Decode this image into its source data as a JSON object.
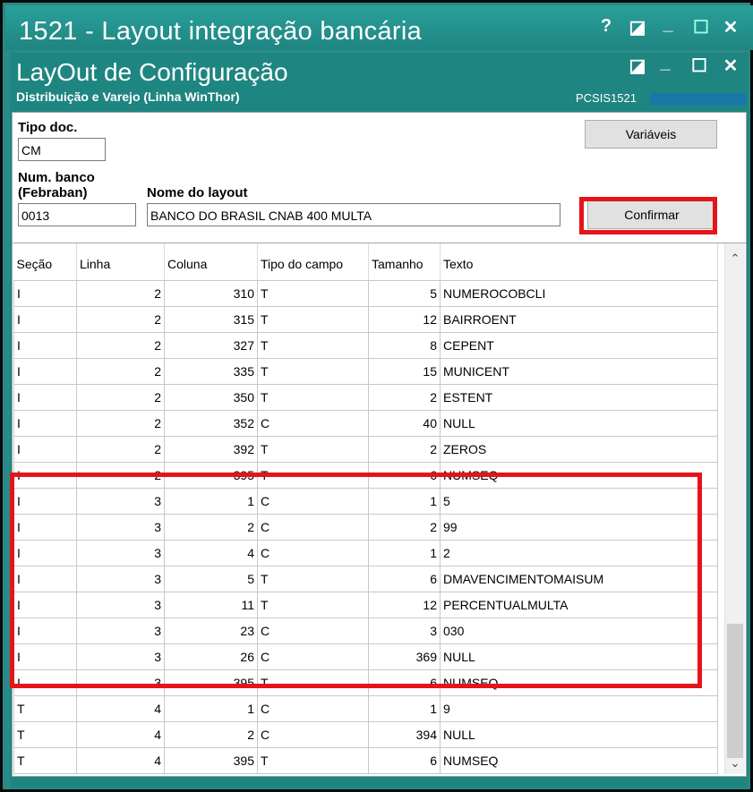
{
  "outer_window": {
    "title": "1521 - Layout integração bancária",
    "help_glyph": "?",
    "restore_glyph": "◪",
    "minimize_glyph": "_",
    "maximize_glyph": "☐",
    "close_glyph": "✕"
  },
  "inner_window": {
    "title": "LayOut de Configuração",
    "subtitle": "Distribuição e Varejo (Linha WinThor)",
    "program_code": "PCSIS1521",
    "restore_glyph": "◪",
    "minimize_glyph": "_",
    "maximize_glyph": "☐",
    "close_glyph": "✕"
  },
  "form": {
    "tipo_doc_label": "Tipo doc.",
    "tipo_doc_value": "CM",
    "num_banco_label_1": "Num. banco",
    "num_banco_label_2": "(Febraban)",
    "num_banco_value": "0013",
    "nome_layout_label": "Nome do layout",
    "nome_layout_value": "BANCO DO BRASIL CNAB 400  MULTA",
    "variaveis_button": "Variáveis",
    "confirmar_button": "Confirmar"
  },
  "grid": {
    "columns": [
      "Seção",
      "Linha",
      "Coluna",
      "Tipo do campo",
      "Tamanho",
      "Texto"
    ],
    "rows": [
      [
        "I",
        "2",
        "310",
        "T",
        "5",
        "NUMEROCOBCLI"
      ],
      [
        "I",
        "2",
        "315",
        "T",
        "12",
        "BAIRROENT"
      ],
      [
        "I",
        "2",
        "327",
        "T",
        "8",
        "CEPENT"
      ],
      [
        "I",
        "2",
        "335",
        "T",
        "15",
        "MUNICENT"
      ],
      [
        "I",
        "2",
        "350",
        "T",
        "2",
        "ESTENT"
      ],
      [
        "I",
        "2",
        "352",
        "C",
        "40",
        "NULL"
      ],
      [
        "I",
        "2",
        "392",
        "T",
        "2",
        "ZEROS"
      ],
      [
        "I",
        "2",
        "395",
        "T",
        "6",
        "NUMSEQ"
      ],
      [
        "I",
        "3",
        "1",
        "C",
        "1",
        "5"
      ],
      [
        "I",
        "3",
        "2",
        "C",
        "2",
        "99"
      ],
      [
        "I",
        "3",
        "4",
        "C",
        "1",
        "2"
      ],
      [
        "I",
        "3",
        "5",
        "T",
        "6",
        "DMAVENCIMENTOMAISUM"
      ],
      [
        "I",
        "3",
        "11",
        "T",
        "12",
        "PERCENTUALMULTA"
      ],
      [
        "I",
        "3",
        "23",
        "C",
        "3",
        "030"
      ],
      [
        "I",
        "3",
        "26",
        "C",
        "369",
        "NULL"
      ],
      [
        "I",
        "3",
        "395",
        "T",
        "6",
        "NUMSEQ"
      ],
      [
        "T",
        "4",
        "1",
        "C",
        "1",
        "9"
      ],
      [
        "T",
        "4",
        "2",
        "C",
        "394",
        "NULL"
      ],
      [
        "T",
        "4",
        "395",
        "T",
        "6",
        "NUMSEQ"
      ]
    ]
  },
  "colors": {
    "titlebar": "#1f8581",
    "highlight": "#e5141b"
  }
}
